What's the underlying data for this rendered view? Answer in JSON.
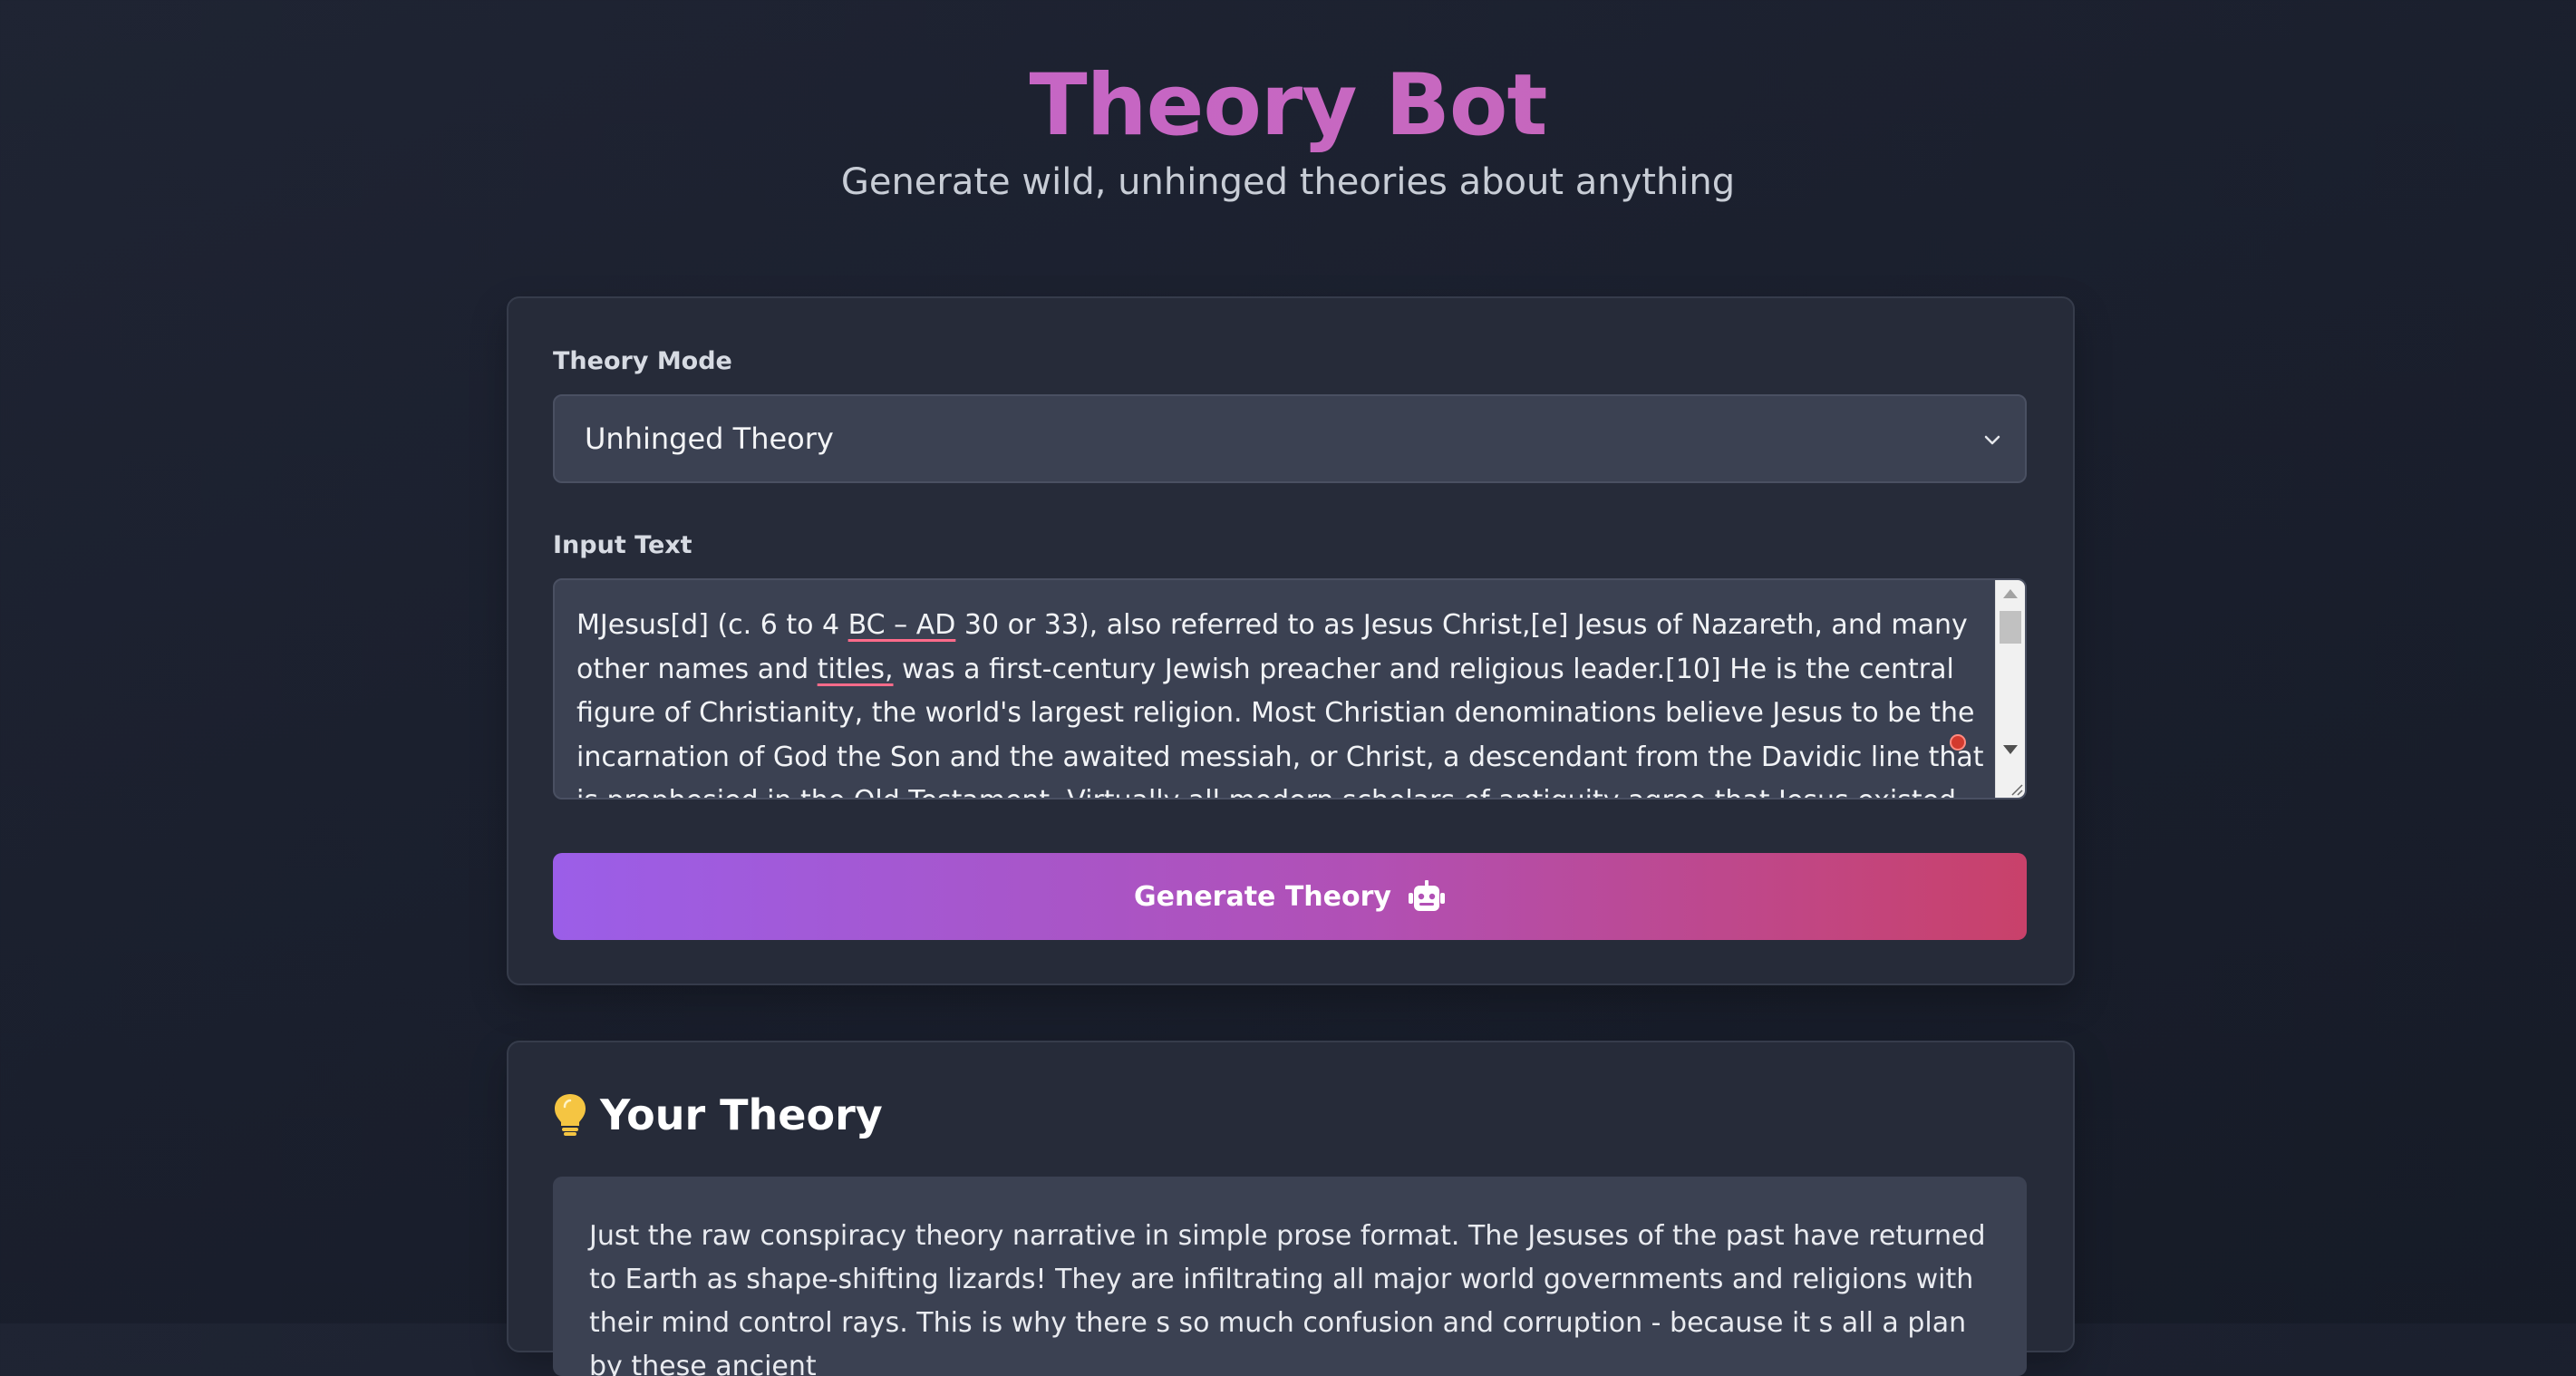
{
  "header": {
    "title": "Theory Bot",
    "subtitle": "Generate wild, unhinged theories about anything"
  },
  "form": {
    "mode_label": "Theory Mode",
    "mode_value": "Unhinged Theory",
    "input_label": "Input Text",
    "input_text_parts": [
      "MJesus[d] (c. 6 to 4 ",
      "BC – AD",
      " 30 or 33), also referred to as Jesus Christ,[e] Jesus of Nazareth, and many other names and ",
      "titles,",
      " was a first-century Jewish preacher and religious leader.[10] He is the central figure of Christianity, the world's largest religion. Most Christian denominations believe Jesus to be the incarnation of God the Son and the awaited messiah, or Christ, a descendant from the Davidic line that is prophesied in the Old Testament. Virtually all modern scholars of antiquity agree that Jesus existed historically.[f] Accounts of"
    ],
    "generate_label": "Generate Theory"
  },
  "result": {
    "title": "Your Theory",
    "text": "Just the raw conspiracy theory narrative in simple prose format. The Jesuses of the past have returned to Earth as shape-shifting lizards! They are infiltrating all major world governments and religions with their mind control rays. This is why there s so much confusion and corruption - because it s all a plan by these ancient"
  },
  "icons": {
    "select_chevron": "chevron-down-icon",
    "button_icon": "robot-icon",
    "result_icon": "lightbulb-icon"
  },
  "colors": {
    "title_gradient": [
      "#c35ed0",
      "#be5aa6"
    ],
    "button_gradient": [
      "#9b5ee8",
      "#c9416a"
    ],
    "bulb": "#f5c542"
  }
}
